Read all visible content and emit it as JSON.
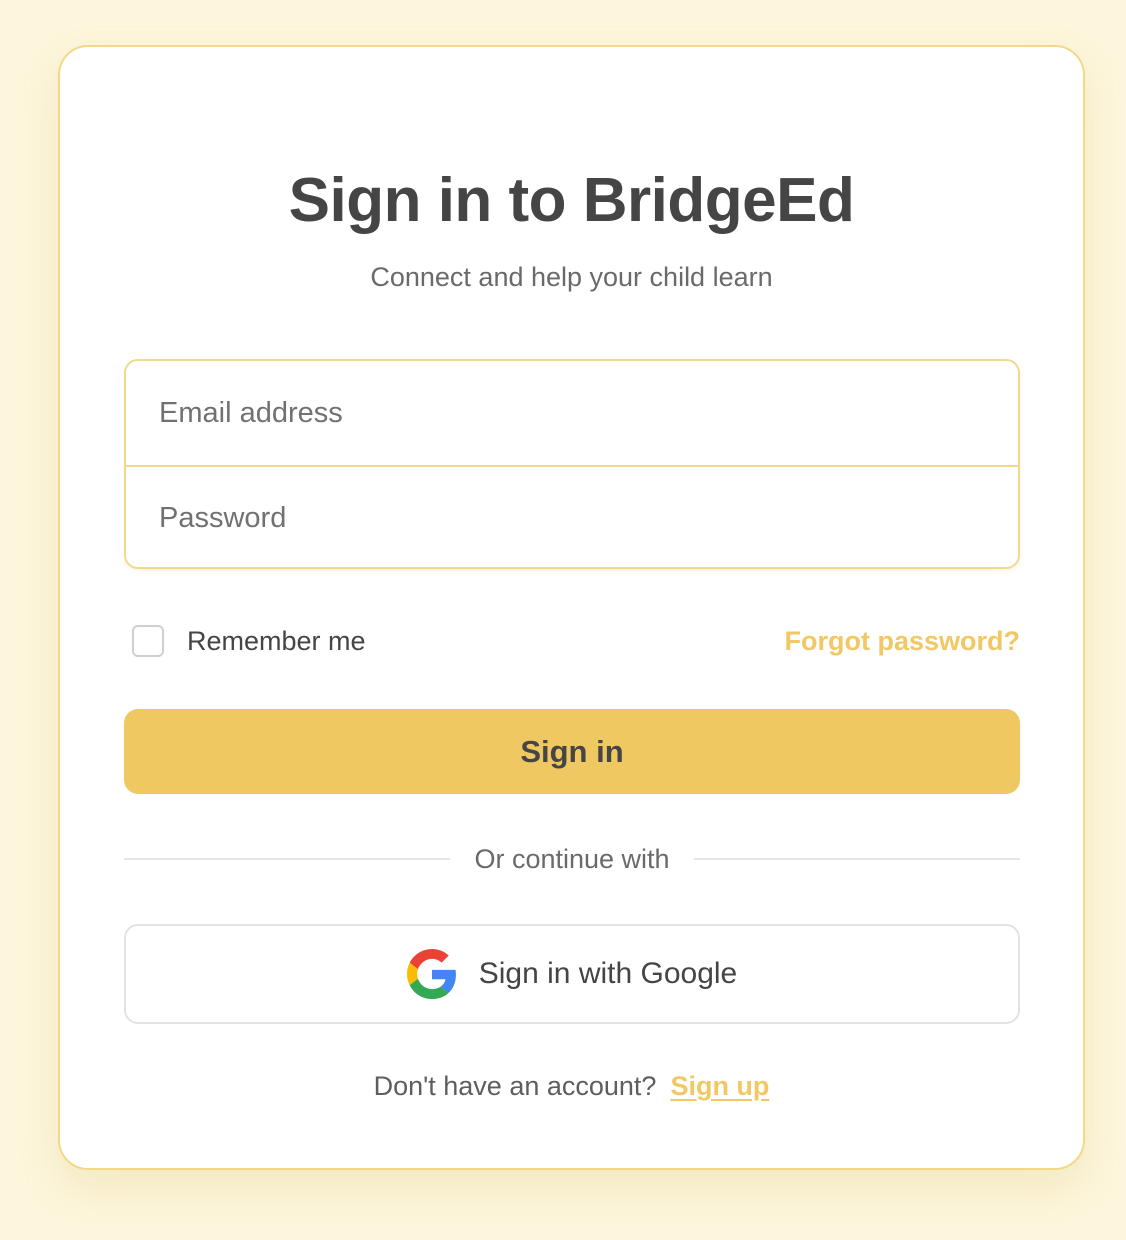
{
  "header": {
    "title": "Sign in to BridgeEd",
    "subtitle": "Connect and help your child learn"
  },
  "form": {
    "email_placeholder": "Email address",
    "password_placeholder": "Password",
    "remember_label": "Remember me",
    "remember_checked": false,
    "forgot_label": "Forgot password?",
    "submit_label": "Sign in"
  },
  "divider": {
    "text": "Or continue with"
  },
  "social": {
    "google_label": "Sign in with Google",
    "google_icon": "google-icon"
  },
  "footer": {
    "prompt": "Don't have an account?",
    "signup_label": "Sign up"
  },
  "colors": {
    "background": "#fdf6dc",
    "accent": "#f0c862",
    "border": "#f2d98a",
    "text": "#454545"
  }
}
